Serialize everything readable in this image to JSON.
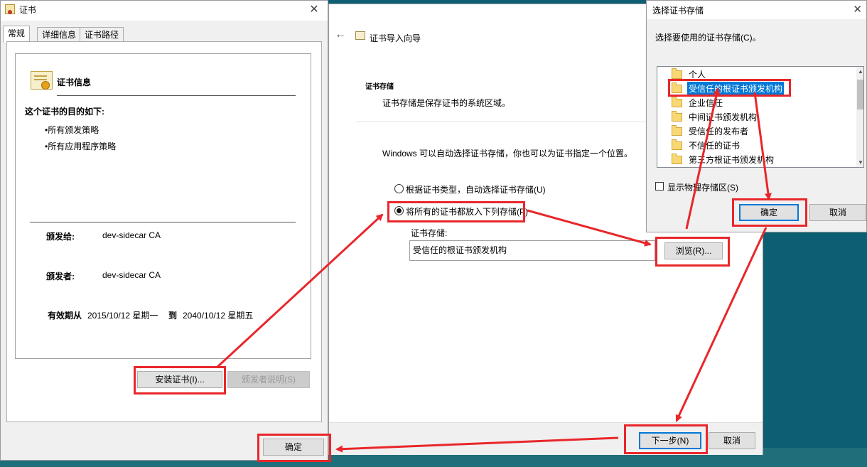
{
  "cert_dialog": {
    "title": "证书",
    "tabs": [
      "常规",
      "详细信息",
      "证书路径"
    ],
    "info_title": "证书信息",
    "purpose_heading": "这个证书的目的如下:",
    "purposes": [
      "•所有颁发策略",
      "•所有应用程序策略"
    ],
    "issued_to_label": "颁发给:",
    "issued_to_value": "dev-sidecar CA",
    "issued_by_label": "颁发者:",
    "issued_by_value": "dev-sidecar CA",
    "validity_label": "有效期从",
    "valid_from": "2015/10/12 星期一",
    "to_label": "到",
    "valid_to": "2040/10/12 星期五",
    "install_button": "安装证书(I)...",
    "issuer_statement_button": "颁发者说明(S)",
    "ok_button": "确定"
  },
  "wizard": {
    "title": "证书导入向导",
    "section_title": "证书存储",
    "section_desc": "证书存储是保存证书的系统区域。",
    "intro": "Windows 可以自动选择证书存储，你也可以为证书指定一个位置。",
    "option_auto": "根据证书类型，自动选择证书存储(U)",
    "option_manual": "将所有的证书都放入下列存储(P)",
    "store_label": "证书存储:",
    "store_value": "受信任的根证书颁发机构",
    "browse_button": "浏览(R)...",
    "next_button": "下一步(N)",
    "cancel_button": "取消"
  },
  "store_dialog": {
    "title": "选择证书存储",
    "prompt": "选择要使用的证书存储(C)。",
    "items": [
      "个人",
      "受信任的根证书颁发机构",
      "企业信任",
      "中间证书颁发机构",
      "受信任的发布者",
      "不信任的证书",
      "第三方根证书颁发机构"
    ],
    "selected_index": 1,
    "show_physical": "显示物理存储区(S)",
    "ok_button": "确定",
    "cancel_button": "取消"
  },
  "colors": {
    "annotation_red": "#e8272b",
    "selection_blue": "#0078d7"
  }
}
